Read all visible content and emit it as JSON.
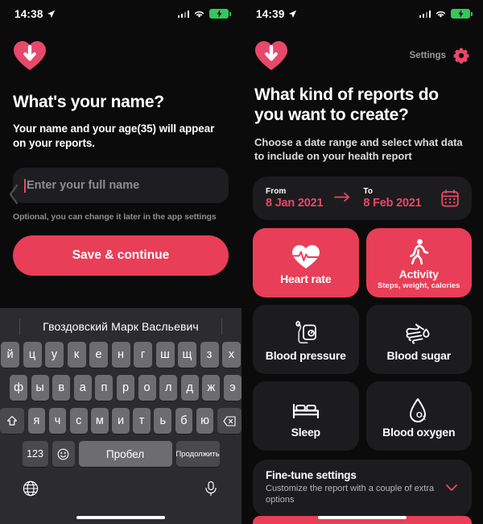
{
  "left": {
    "status": {
      "time": "14:38",
      "location_icon": "location-arrow-icon",
      "wifi_icon": "wifi-icon",
      "signal_icon": "cellular-signal-icon",
      "battery_icon": "battery-charging-icon"
    },
    "logo": "heart-download-logo",
    "title": "What's your name?",
    "subtitle": "Your name and your age(35) will appear on your reports.",
    "input": {
      "placeholder": "Enter your full name",
      "value": ""
    },
    "hint": "Optional, you can change it later in the app settings",
    "cta": "Save & continue",
    "keyboard": {
      "prediction": "Гвоздовский Марк Васльевич",
      "row1": [
        "й",
        "ц",
        "у",
        "к",
        "е",
        "н",
        "г",
        "ш",
        "щ",
        "з",
        "х"
      ],
      "row2": [
        "ф",
        "ы",
        "в",
        "а",
        "п",
        "р",
        "о",
        "л",
        "д",
        "ж",
        "э"
      ],
      "row3": [
        "я",
        "ч",
        "с",
        "м",
        "и",
        "т",
        "ь",
        "б",
        "ю"
      ],
      "shift_icon": "shift-icon",
      "backspace_icon": "backspace-icon",
      "numbers_key": "123",
      "emoji_icon": "emoji-icon",
      "space_key": "Пробел",
      "continue_key": "Продолжить",
      "globe_icon": "globe-icon",
      "mic_icon": "microphone-icon"
    }
  },
  "right": {
    "status": {
      "time": "14:39",
      "location_icon": "location-arrow-icon",
      "wifi_icon": "wifi-icon",
      "signal_icon": "cellular-signal-icon",
      "battery_icon": "battery-charging-icon"
    },
    "logo": "heart-download-logo",
    "settings_label": "Settings",
    "settings_icon": "gear-icon",
    "title": "What kind of reports do you want to create?",
    "subtitle": "Choose a date range and select what data to include on your health report",
    "date_range": {
      "from_label": "From",
      "from_value": "8 Jan 2021",
      "arrow_icon": "arrow-right-icon",
      "to_label": "To",
      "to_value": "8 Feb 2021",
      "calendar_icon": "calendar-icon"
    },
    "tiles": [
      {
        "label": "Heart rate",
        "desc": "",
        "icon": "heart-pulse-icon",
        "selected": true
      },
      {
        "label": "Activity",
        "desc": "Steps, weight, calories",
        "icon": "walking-person-icon",
        "selected": true
      },
      {
        "label": "Blood pressure",
        "desc": "",
        "icon": "blood-pressure-monitor-icon",
        "selected": false
      },
      {
        "label": "Blood sugar",
        "desc": "",
        "icon": "finger-prick-drop-icon",
        "selected": false
      },
      {
        "label": "Sleep",
        "desc": "",
        "icon": "bed-icon",
        "selected": false
      },
      {
        "label": "Blood oxygen",
        "desc": "",
        "icon": "o2-droplet-icon",
        "selected": false
      }
    ],
    "finetune": {
      "title": "Fine-tune settings",
      "desc": "Customize the report with a couple of extra options",
      "chevron_icon": "chevron-down-icon"
    }
  },
  "colors": {
    "accent": "#e83e57",
    "card": "#1c1c1e",
    "background": "#0b0b0b",
    "keyboard": "#2c2c2e",
    "key": "#6d6d6f"
  }
}
